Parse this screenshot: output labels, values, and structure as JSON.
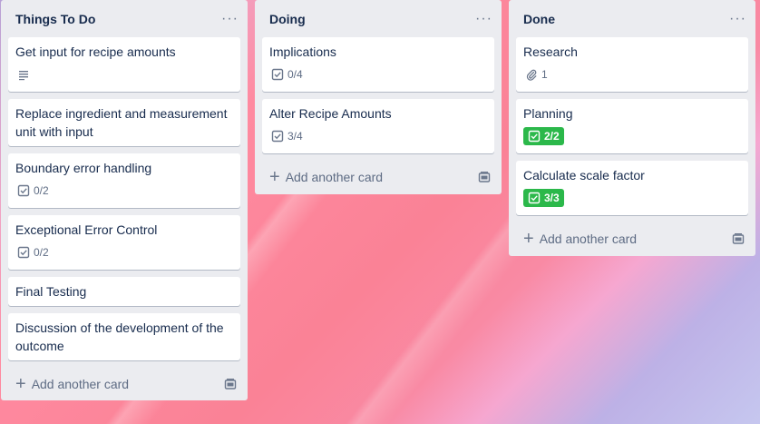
{
  "lists": [
    {
      "title": "Things To Do",
      "menu": "···",
      "add_label": "Add another card",
      "cards": [
        {
          "title": "Get input for recipe amounts",
          "badge_icon": "description-icon"
        },
        {
          "title": "Replace ingredient and measurement unit with input"
        },
        {
          "title": "Boundary error handling",
          "checklist": "0/2"
        },
        {
          "title": "Exceptional Error Control",
          "checklist": "0/2"
        },
        {
          "title": "Final Testing"
        },
        {
          "title": "Discussion of the development of the outcome"
        }
      ]
    },
    {
      "title": "Doing",
      "menu": "···",
      "add_label": "Add another card",
      "cards": [
        {
          "title": "Implications",
          "checklist": "0/4"
        },
        {
          "title": "Alter Recipe Amounts",
          "checklist": "3/4"
        }
      ]
    },
    {
      "title": "Done",
      "menu": "···",
      "add_label": "Add another card",
      "cards": [
        {
          "title": "Research",
          "attachments": "1"
        },
        {
          "title": "Planning",
          "checklist": "2/2",
          "complete": true
        },
        {
          "title": "Calculate scale factor",
          "checklist": "3/3",
          "complete": true
        }
      ]
    }
  ],
  "colors": {
    "complete_badge": "#2bb84a",
    "list_bg": "#ebecf0",
    "text": "#172b4d"
  }
}
